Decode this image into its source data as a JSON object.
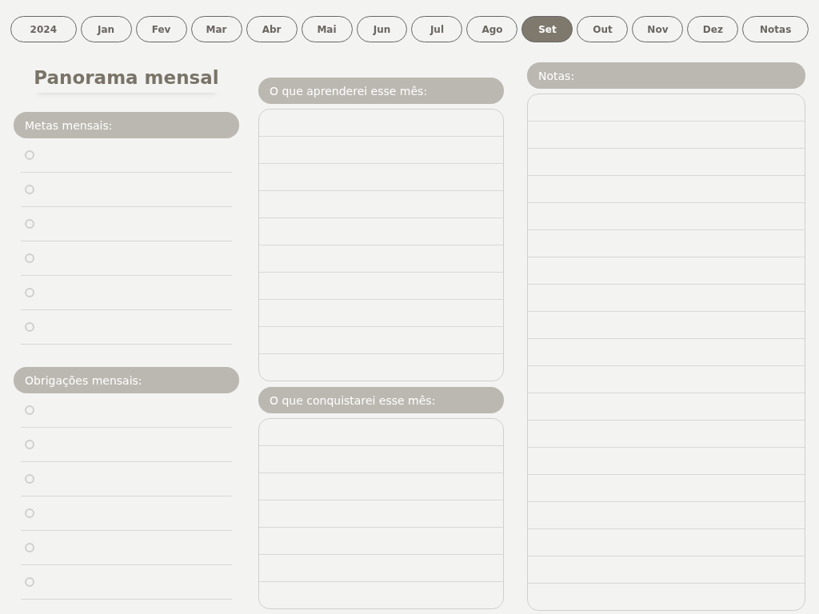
{
  "tabs": [
    {
      "label": "2024",
      "selected": false
    },
    {
      "label": "Jan",
      "selected": false
    },
    {
      "label": "Fev",
      "selected": false
    },
    {
      "label": "Mar",
      "selected": false
    },
    {
      "label": "Abr",
      "selected": false
    },
    {
      "label": "Mai",
      "selected": false
    },
    {
      "label": "Jun",
      "selected": false
    },
    {
      "label": "Jul",
      "selected": false
    },
    {
      "label": "Ago",
      "selected": false
    },
    {
      "label": "Set",
      "selected": true
    },
    {
      "label": "Out",
      "selected": false
    },
    {
      "label": "Nov",
      "selected": false
    },
    {
      "label": "Dez",
      "selected": false
    },
    {
      "label": "Notas",
      "selected": false
    }
  ],
  "title": "Panorama mensal",
  "goals": {
    "heading": "Metas mensais:",
    "items": [
      {
        "checked": false
      },
      {
        "checked": false
      },
      {
        "checked": false
      },
      {
        "checked": false
      },
      {
        "checked": false
      },
      {
        "checked": false
      }
    ]
  },
  "obligations": {
    "heading": "Obrigações mensais:",
    "items": [
      {
        "checked": false
      },
      {
        "checked": false
      },
      {
        "checked": false
      },
      {
        "checked": false
      },
      {
        "checked": false
      },
      {
        "checked": false
      }
    ]
  },
  "learn": {
    "heading": "O que aprenderei esse mês:"
  },
  "achieve": {
    "heading": "O que conquistarei esse mês:"
  },
  "notes": {
    "heading": "Notas:"
  }
}
